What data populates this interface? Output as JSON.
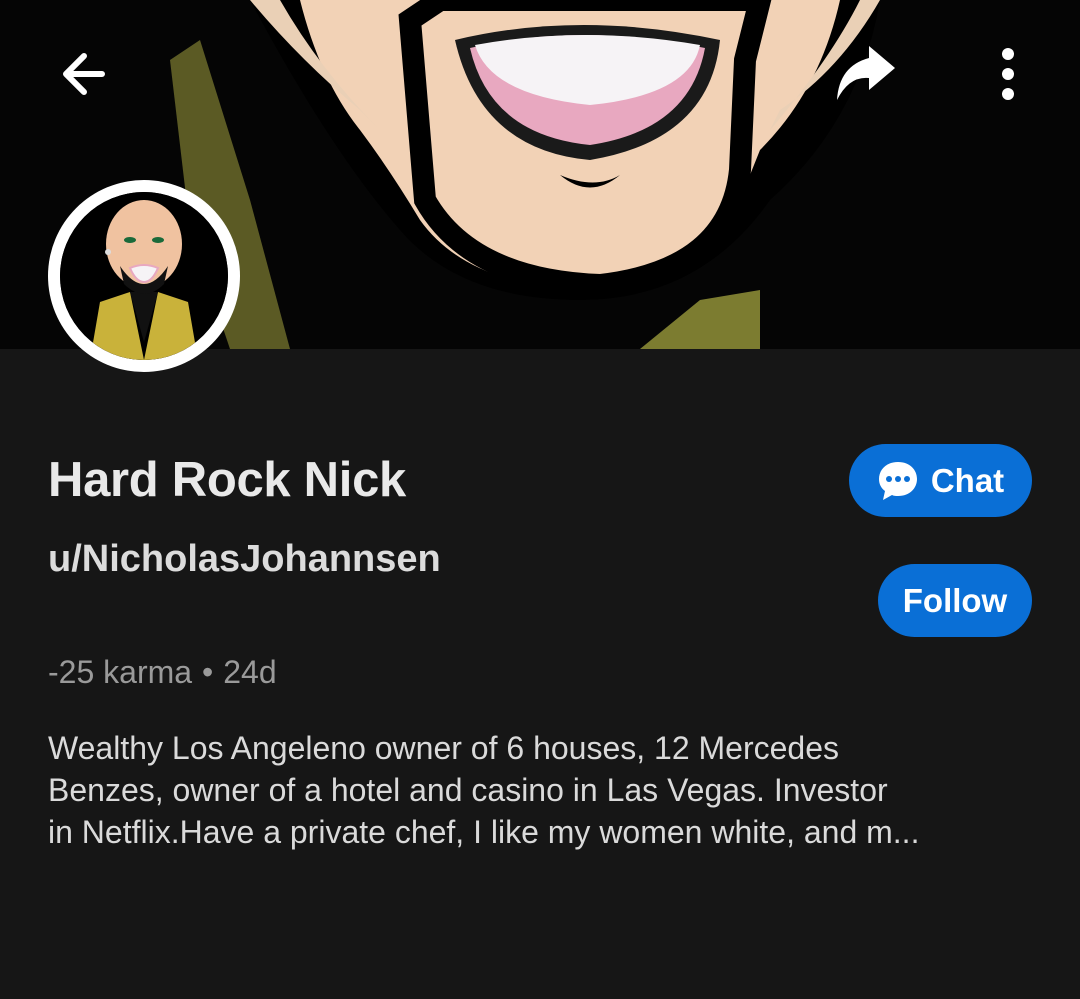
{
  "header": {
    "back_icon": "arrow-left-icon",
    "share_icon": "share-arrow-icon",
    "more_icon": "vertical-dots-icon"
  },
  "profile": {
    "display_name": "Hard Rock Nick",
    "username": "u/NicholasJohannsen",
    "karma": "-25 karma",
    "separator": "•",
    "age": "24d",
    "bio_lines": [
      "Wealthy Los Angeleno owner of 6 houses, 12 Mercedes",
      "Benzes, owner of a hotel and casino in Las Vegas. Investor",
      "in Netflix.Have a private chef, I like my women white, and m..."
    ]
  },
  "actions": {
    "chat_label": "Chat",
    "chat_icon": "chat-bubble-icon",
    "follow_label": "Follow"
  },
  "colors": {
    "background": "#161616",
    "accent": "#0a6fd6",
    "text_primary": "#e9e9e9",
    "text_muted": "#9a9a9a"
  }
}
